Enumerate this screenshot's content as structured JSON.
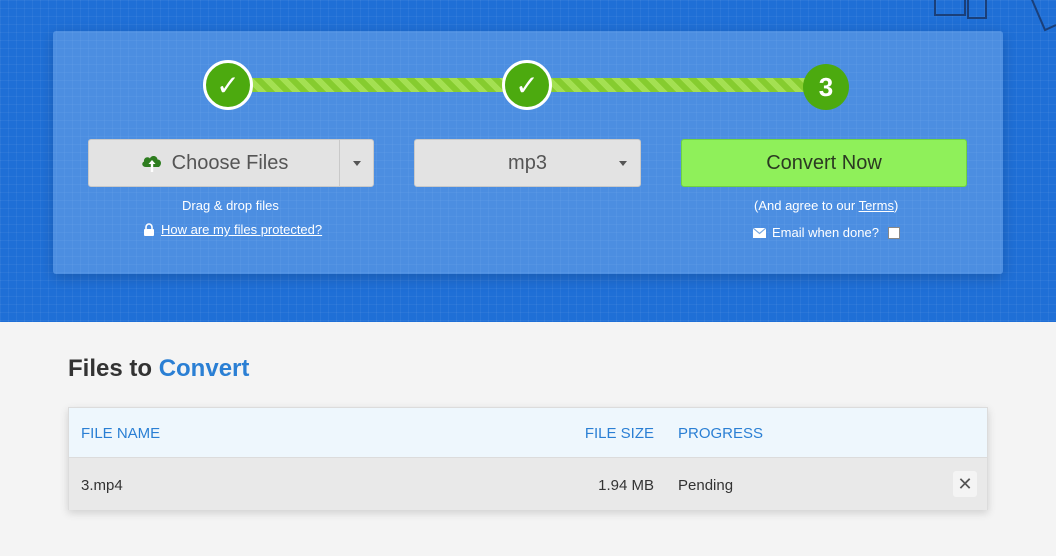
{
  "steps": [
    {
      "state": "done",
      "mark": "✓"
    },
    {
      "state": "done",
      "mark": "✓"
    },
    {
      "state": "current",
      "mark": "3"
    }
  ],
  "upload": {
    "button_label": "Choose Files",
    "icon": "cloud-upload-icon",
    "drag_hint": "Drag & drop files",
    "protect_link": "How are my files protected?"
  },
  "format": {
    "selected": "mp3"
  },
  "convert": {
    "button_label": "Convert Now",
    "agree_prefix": "(And agree to our ",
    "terms_link": "Terms",
    "agree_suffix": ")",
    "email_label": "Email when done?"
  },
  "files_section": {
    "title_plain": "Files to ",
    "title_accent": "Convert",
    "columns": {
      "name": "FILE NAME",
      "size": "FILE SIZE",
      "progress": "PROGRESS"
    },
    "rows": [
      {
        "name": "3.mp4",
        "size": "1.94 MB",
        "progress": "Pending"
      }
    ]
  },
  "colors": {
    "hero_blue": "#1f6fd6",
    "step_green": "#4caa0f",
    "convert_green": "#8ff05a",
    "accent_blue": "#2a7fd4"
  }
}
